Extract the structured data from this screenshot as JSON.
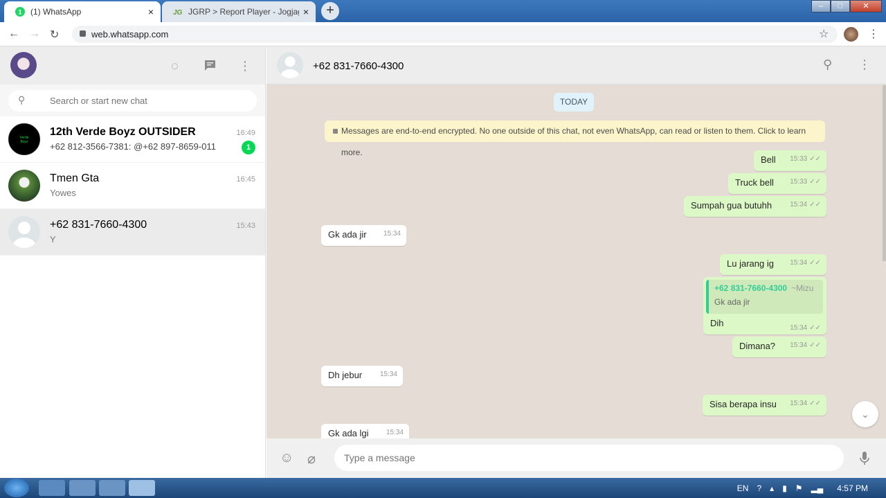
{
  "browser": {
    "tabs": [
      {
        "title": "(1) WhatsApp",
        "favicon": "whatsapp-icon"
      },
      {
        "title": "JGRP > Report Player - Jogjagam",
        "favicon": "jgrp-icon"
      }
    ],
    "close_glyph": "×",
    "newtab_glyph": "+",
    "url": "web.whatsapp.com"
  },
  "sidebar": {
    "search_placeholder": "Search or start new chat",
    "chats": [
      {
        "name": "12th Verde Boyz OUTSIDER",
        "preview": "+62 812-3566-7381: @+62 897-8659-011",
        "time": "16:49",
        "unread": "1"
      },
      {
        "name": "Tmen Gta",
        "preview": "Yowes",
        "time": "16:45"
      },
      {
        "name": "+62 831-7660-4300",
        "preview": "Y",
        "time": "15:43"
      }
    ]
  },
  "conversation": {
    "contact": "+62 831-7660-4300",
    "date_label": "TODAY",
    "encryption_notice": "Messages are end-to-end encrypted. No one outside of this chat, not even WhatsApp, can read or listen to them. Click to learn more.",
    "messages": [
      {
        "dir": "out",
        "text": "Bell",
        "time": "15:33"
      },
      {
        "dir": "out",
        "text": "Truck bell",
        "time": "15:33"
      },
      {
        "dir": "out",
        "text": "Sumpah gua butuhh",
        "time": "15:34"
      },
      {
        "dir": "in",
        "text": "Gk ada jir",
        "time": "15:34"
      },
      {
        "dir": "out",
        "text": "Lu jarang ig",
        "time": "15:34"
      },
      {
        "dir": "out",
        "text": "Dih",
        "time": "15:34",
        "quote": {
          "author": "+62 831-7660-4300",
          "alias": "~Mizu",
          "text": "Gk ada jir"
        }
      },
      {
        "dir": "out",
        "text": "Dimana?",
        "time": "15:34"
      },
      {
        "dir": "in",
        "text": "Dh jebur",
        "time": "15:34"
      },
      {
        "dir": "out",
        "text": "Sisa berapa insu",
        "time": "15:34"
      },
      {
        "dir": "in",
        "text": "Gk ada lgi",
        "time": "15:34"
      }
    ],
    "input_placeholder": "Type a message"
  },
  "taskbar": {
    "lang": "EN",
    "clock": "4:57 PM"
  },
  "colors": {
    "accent": "#06d755",
    "bubble_out": "#dcf8c6",
    "chat_bg": "#e5ddd5"
  }
}
